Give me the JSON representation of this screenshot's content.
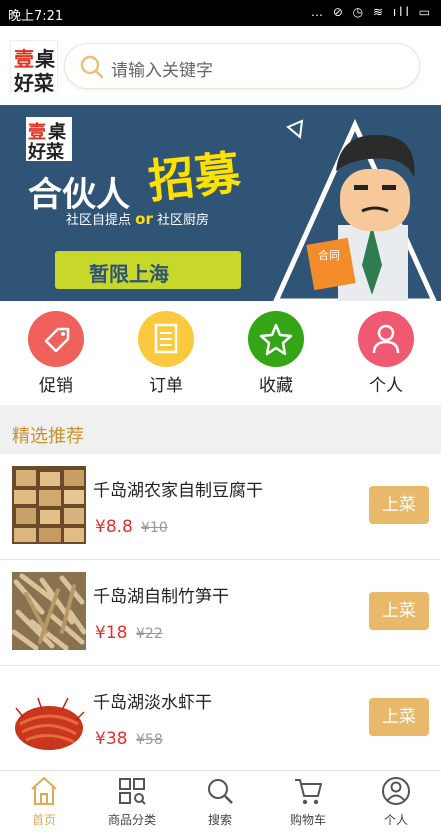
{
  "status": {
    "time": "晚上7:21",
    "icons": "… ⊘ ◷ ≋ ıll ▭"
  },
  "header": {
    "logo": {
      "c1": "壹",
      "c2": "桌",
      "c3": "好菜"
    },
    "search_placeholder": "请输入关键字"
  },
  "banner": {
    "title": "合伙人",
    "highlight": "招募",
    "sub_left": "社区自提点",
    "sub_or": "or",
    "sub_right": "社区厨房",
    "ribbon": "暂限上海",
    "badge": "合同"
  },
  "shortcuts": [
    {
      "label": "促销",
      "icon": "tag-icon",
      "color": "#f1615b"
    },
    {
      "label": "订单",
      "icon": "document-icon",
      "color": "#fbc93d"
    },
    {
      "label": "收藏",
      "icon": "star-icon",
      "color": "#34a514"
    },
    {
      "label": "个人",
      "icon": "person-icon",
      "color": "#ef5a72"
    }
  ],
  "section_title": "精选推荐",
  "products": [
    {
      "name": "千岛湖农家自制豆腐干",
      "price": "¥8.8",
      "old_price": "¥10",
      "button": "上菜"
    },
    {
      "name": "千岛湖自制竹笋干",
      "price": "¥18",
      "old_price": "¥22",
      "button": "上菜"
    },
    {
      "name": "千岛湖淡水虾干",
      "price": "¥38",
      "old_price": "¥58",
      "button": "上菜"
    }
  ],
  "tabs": [
    {
      "label": "首页",
      "icon": "home-icon",
      "active": true
    },
    {
      "label": "商品分类",
      "icon": "grid-icon",
      "active": false
    },
    {
      "label": "搜索",
      "icon": "search-icon",
      "active": false
    },
    {
      "label": "购物车",
      "icon": "cart-icon",
      "active": false
    },
    {
      "label": "个人",
      "icon": "user-icon",
      "active": false
    }
  ],
  "colors": {
    "accent": "#e0a857",
    "price": "#e23030",
    "button": "#e8b96a",
    "banner_bg": "#2f5476"
  }
}
